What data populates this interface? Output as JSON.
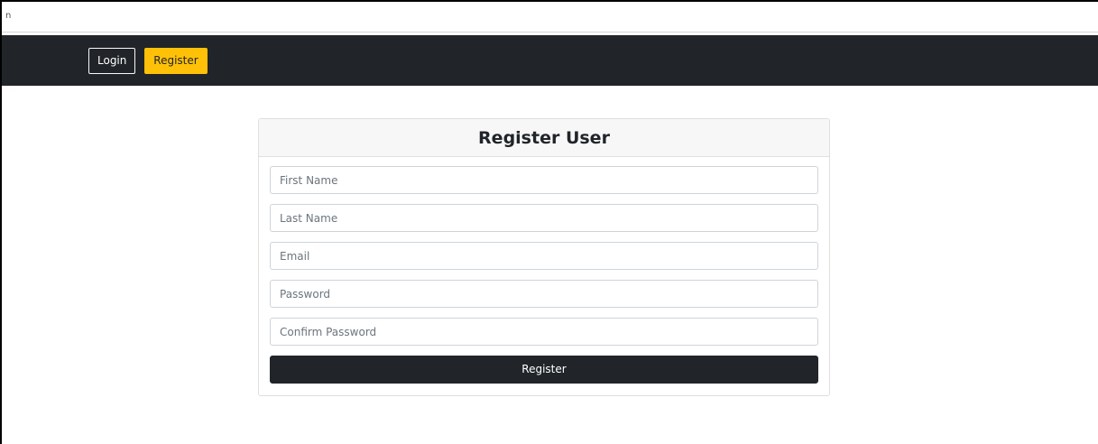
{
  "navbar": {
    "login_label": "Login",
    "register_label": "Register"
  },
  "register_form": {
    "title": "Register User",
    "fields": [
      {
        "placeholder": "First Name",
        "value": ""
      },
      {
        "placeholder": "Last Name",
        "value": ""
      },
      {
        "placeholder": "Email",
        "value": ""
      },
      {
        "placeholder": "Password",
        "value": ""
      },
      {
        "placeholder": "Confirm Password",
        "value": ""
      }
    ],
    "submit_label": "Register"
  },
  "colors": {
    "navbar_bg": "#212529",
    "accent": "#ffc107",
    "submit_bg": "#212529",
    "card_header_bg": "#f7f7f7"
  }
}
